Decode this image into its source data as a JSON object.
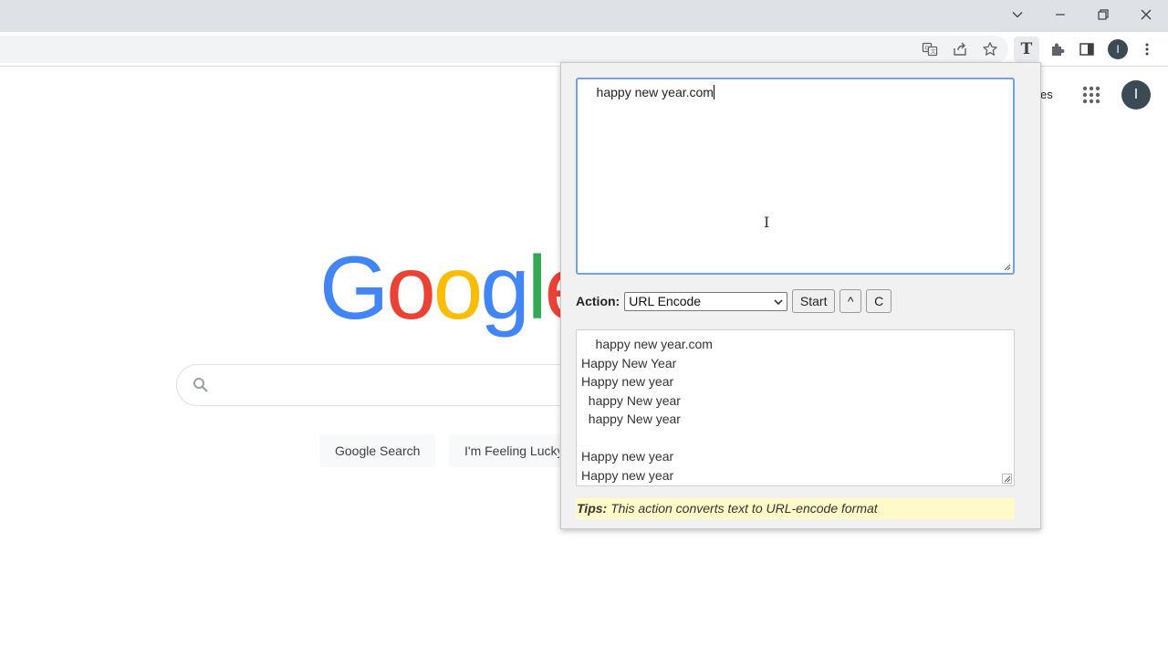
{
  "browser": {
    "toolbar_icons": [
      "translate-icon",
      "share-icon",
      "bookmark-star-icon",
      "text-extension-icon",
      "extensions-puzzle-icon",
      "side-panel-icon",
      "profile-avatar",
      "menu-kebab-icon"
    ],
    "extension_letter": "T",
    "profile_initial": "I"
  },
  "google": {
    "header_link_partial": "es",
    "avatar_initial": "I",
    "logo_letters": [
      "G",
      "o",
      "o",
      "g",
      "l",
      "e"
    ],
    "logo_colors": [
      "#4285f4",
      "#ea4335",
      "#fbbc05",
      "#4285f4",
      "#34a853",
      "#ea4335"
    ],
    "search_button": "Google Search",
    "lucky_button": "I'm Feeling Lucky"
  },
  "popup": {
    "input_text": "    happy new year.com",
    "action_label": "Action:",
    "action_selected": "URL Encode",
    "start_button": "Start",
    "up_button": "^",
    "clear_button": "C",
    "output_lines": [
      "    happy new year.com",
      "Happy New Year",
      "Happy new year",
      "  happy New year",
      "  happy New year",
      "",
      "Happy new year",
      "Happy new year"
    ],
    "tips_label": "Tips:",
    "tips_text": "This action converts text to URL-encode format"
  }
}
